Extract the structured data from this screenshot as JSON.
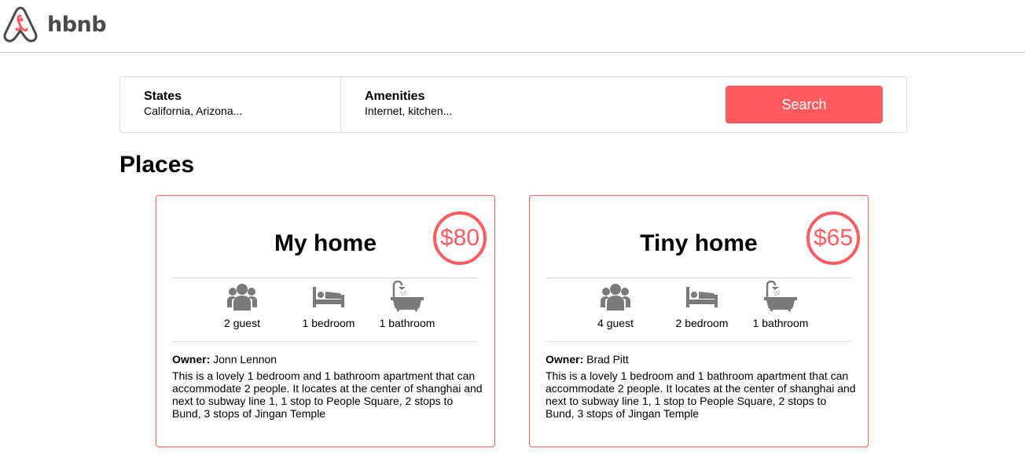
{
  "header": {
    "logo_text": "hbnb",
    "logo_icon": "airbnb-logo-icon",
    "logo_color": "#ff5a5f"
  },
  "filters": {
    "states_title": "States",
    "states_value": "California, Arizona...",
    "amenities_title": "Amenities",
    "amenities_value": "Internet, kitchen...",
    "search_label": "Search"
  },
  "places_title": "Places",
  "colors": {
    "accent": "#ff5a5f",
    "icon": "#7a7a7a",
    "divider": "#dddddd"
  },
  "places": [
    {
      "name": "My home",
      "price": "$80",
      "guests": "2 guest",
      "bedrooms": "1 bedroom",
      "bathrooms": "1 bathroom",
      "owner_label": "Owner:",
      "owner": "Jonn Lennon",
      "description": "This is a lovely 1 bedroom and 1 bathroom apartment that can accommodate 2 people. It locates at the center of shanghai and next to subway line 1, 1 stop to People Square, 2 stops to Bund, 3 stops of Jingan Temple"
    },
    {
      "name": "Tiny home",
      "price": "$65",
      "guests": "4 guest",
      "bedrooms": "2 bedroom",
      "bathrooms": "1 bathroom",
      "owner_label": "Owner:",
      "owner": "Brad Pitt",
      "description": "This is a lovely 1 bedroom and 1 bathroom apartment that can accommodate 2 people. It locates at the center of shanghai and next to subway line 1, 1 stop to People Square, 2 stops to Bund, 3 stops of Jingan Temple"
    }
  ]
}
